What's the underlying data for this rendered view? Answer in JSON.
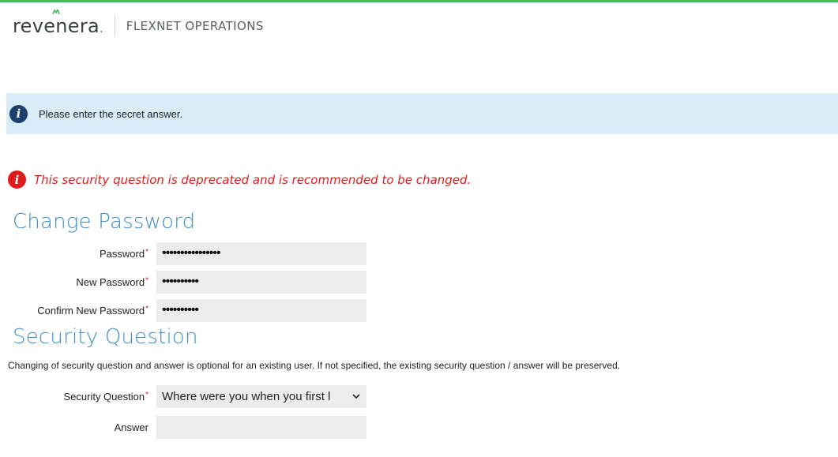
{
  "header": {
    "logo_text": "revenera",
    "logo_suffix": ".",
    "product": "FLEXNET OPERATIONS"
  },
  "info_banner": {
    "icon_glyph": "i",
    "text": "Please enter the secret answer."
  },
  "warning": {
    "icon_glyph": "i",
    "text": "This security question is deprecated and is recommended to be changed."
  },
  "change_password": {
    "title": "Change Password",
    "fields": [
      {
        "label": "Password",
        "required_mark": "*",
        "value": "••••••••••••••••"
      },
      {
        "label": "New Password",
        "required_mark": "*",
        "value": "••••••••••"
      },
      {
        "label": "Confirm New Password",
        "required_mark": "*",
        "value": "••••••••••"
      }
    ]
  },
  "security_question": {
    "title": "Security Question",
    "description": "Changing of security question and answer is optional for an existing user. If not specified, the existing security question / answer will be preserved.",
    "question_label": "Security Question",
    "required_mark": "*",
    "question_value": "Where were you when you first l",
    "answer_label": "Answer",
    "answer_value": ""
  },
  "colors": {
    "accent_green": "#3dbf5b",
    "title_blue": "#3f8fc9",
    "info_bg": "#d9edf9",
    "info_icon": "#1d3f6e",
    "warning_red": "#e01b1b"
  },
  "icons": {
    "info": "info-icon",
    "warning": "warning-icon",
    "dropdown": "chevron-down-icon"
  }
}
